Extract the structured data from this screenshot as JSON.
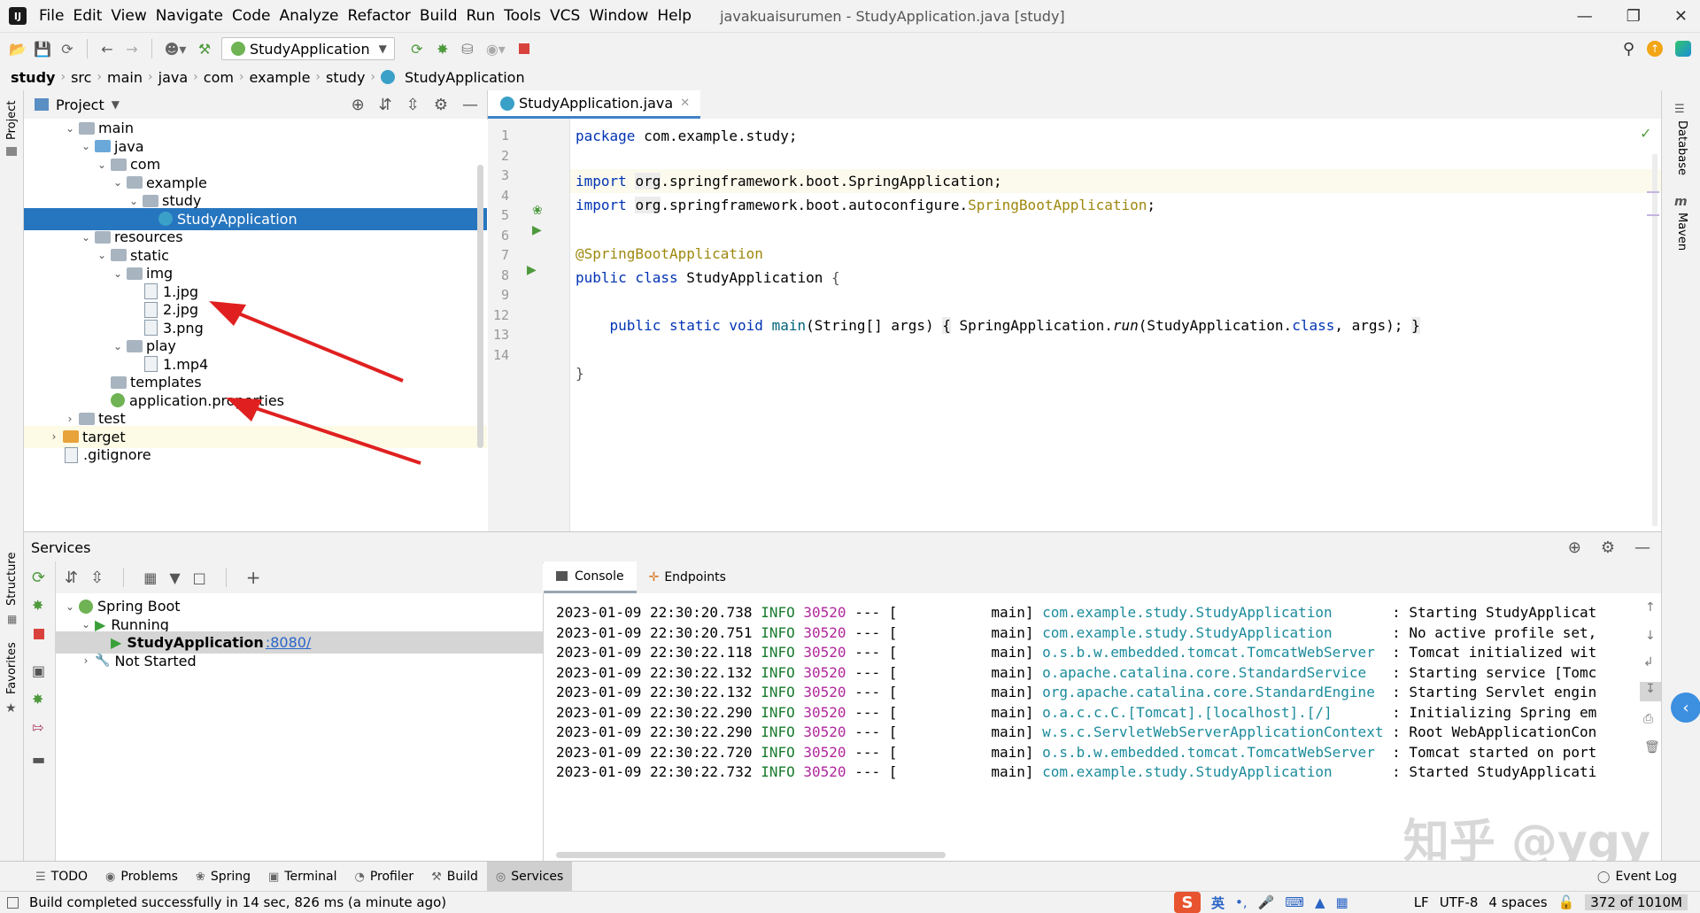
{
  "menu": [
    "File",
    "Edit",
    "View",
    "Navigate",
    "Code",
    "Analyze",
    "Refactor",
    "Build",
    "Run",
    "Tools",
    "VCS",
    "Window",
    "Help"
  ],
  "window_title": "javakuaisurumen - StudyApplication.java [study]",
  "toolbar": {
    "run_config": "StudyApplication"
  },
  "breadcrumbs": [
    "study",
    "src",
    "main",
    "java",
    "com",
    "example",
    "study",
    "StudyApplication"
  ],
  "left_strip": [
    "Project",
    "Structure",
    "Favorites"
  ],
  "right_strip": [
    "Database",
    "Maven"
  ],
  "project": {
    "header": "Project",
    "tree": [
      {
        "label": "main",
        "depth": 2,
        "chev": "v",
        "icon": "folder"
      },
      {
        "label": "java",
        "depth": 3,
        "chev": "v",
        "icon": "folder-blue"
      },
      {
        "label": "com",
        "depth": 4,
        "chev": "v",
        "icon": "folder"
      },
      {
        "label": "example",
        "depth": 5,
        "chev": "v",
        "icon": "folder"
      },
      {
        "label": "study",
        "depth": 6,
        "chev": "v",
        "icon": "folder"
      },
      {
        "label": "StudyApplication",
        "depth": 7,
        "chev": "",
        "icon": "class",
        "selected": true
      },
      {
        "label": "resources",
        "depth": 3,
        "chev": "v",
        "icon": "folder"
      },
      {
        "label": "static",
        "depth": 4,
        "chev": "v",
        "icon": "folder"
      },
      {
        "label": "img",
        "depth": 5,
        "chev": "v",
        "icon": "folder"
      },
      {
        "label": "1.jpg",
        "depth": 6,
        "chev": "",
        "icon": "file"
      },
      {
        "label": "2.jpg",
        "depth": 6,
        "chev": "",
        "icon": "file"
      },
      {
        "label": "3.png",
        "depth": 6,
        "chev": "",
        "icon": "file"
      },
      {
        "label": "play",
        "depth": 5,
        "chev": "v",
        "icon": "folder"
      },
      {
        "label": "1.mp4",
        "depth": 6,
        "chev": "",
        "icon": "file"
      },
      {
        "label": "templates",
        "depth": 4,
        "chev": "",
        "icon": "folder"
      },
      {
        "label": "application.properties",
        "depth": 4,
        "chev": "",
        "icon": "leaf"
      },
      {
        "label": "test",
        "depth": 2,
        "chev": ">",
        "icon": "folder"
      },
      {
        "label": "target",
        "depth": 1,
        "chev": ">",
        "icon": "folder-orange",
        "highlight": true
      },
      {
        "label": ".gitignore",
        "depth": 1,
        "chev": "",
        "icon": "file"
      }
    ]
  },
  "editor": {
    "tab": "StudyApplication.java",
    "line_numbers": [
      "1",
      "2",
      "3",
      "4",
      "5",
      "6",
      "7",
      "8",
      "9",
      "12",
      "13",
      "14"
    ]
  },
  "services": {
    "header": "Services",
    "tree": [
      {
        "label": "Spring Boot",
        "depth": 0
      },
      {
        "label": "Running",
        "depth": 1
      },
      {
        "label": "StudyApplication",
        "port": ":8080/",
        "depth": 2,
        "selected": true
      },
      {
        "label": "Not Started",
        "depth": 1
      }
    ],
    "console_tabs": [
      "Console",
      "Endpoints"
    ],
    "logs": [
      {
        "ts": "2023-01-09 22:30:20.738",
        "lvl": "INFO",
        "pid": "30520",
        "thread": "---",
        "bracket": "[           main]",
        "logger": "com.example.study.StudyApplication      ",
        "msg": ": Starting StudyApplicat"
      },
      {
        "ts": "2023-01-09 22:30:20.751",
        "lvl": "INFO",
        "pid": "30520",
        "thread": "---",
        "bracket": "[           main]",
        "logger": "com.example.study.StudyApplication      ",
        "msg": ": No active profile set,"
      },
      {
        "ts": "2023-01-09 22:30:22.118",
        "lvl": "INFO",
        "pid": "30520",
        "thread": "---",
        "bracket": "[           main]",
        "logger": "o.s.b.w.embedded.tomcat.TomcatWebServer ",
        "msg": ": Tomcat initialized wit"
      },
      {
        "ts": "2023-01-09 22:30:22.132",
        "lvl": "INFO",
        "pid": "30520",
        "thread": "---",
        "bracket": "[           main]",
        "logger": "o.apache.catalina.core.StandardService  ",
        "msg": ": Starting service [Tomc"
      },
      {
        "ts": "2023-01-09 22:30:22.132",
        "lvl": "INFO",
        "pid": "30520",
        "thread": "---",
        "bracket": "[           main]",
        "logger": "org.apache.catalina.core.StandardEngine ",
        "msg": ": Starting Servlet engin"
      },
      {
        "ts": "2023-01-09 22:30:22.290",
        "lvl": "INFO",
        "pid": "30520",
        "thread": "---",
        "bracket": "[           main]",
        "logger": "o.a.c.c.C.[Tomcat].[localhost].[/]      ",
        "msg": ": Initializing Spring em"
      },
      {
        "ts": "2023-01-09 22:30:22.290",
        "lvl": "INFO",
        "pid": "30520",
        "thread": "---",
        "bracket": "[           main]",
        "logger": "w.s.c.ServletWebServerApplicationContext",
        "msg": ": Root WebApplicationCon"
      },
      {
        "ts": "2023-01-09 22:30:22.720",
        "lvl": "INFO",
        "pid": "30520",
        "thread": "---",
        "bracket": "[           main]",
        "logger": "o.s.b.w.embedded.tomcat.TomcatWebServer ",
        "msg": ": Tomcat started on port"
      },
      {
        "ts": "2023-01-09 22:30:22.732",
        "lvl": "INFO",
        "pid": "30520",
        "thread": "---",
        "bracket": "[           main]",
        "logger": "com.example.study.StudyApplication      ",
        "msg": ": Started StudyApplicati"
      }
    ]
  },
  "bottom_tabs": [
    "TODO",
    "Problems",
    "Spring",
    "Terminal",
    "Profiler",
    "Build",
    "Services"
  ],
  "bottom_active": "Services",
  "event_log": "Event Log",
  "status": {
    "message": "Build completed successfully in 14 sec, 826 ms (a minute ago)",
    "ime": [
      "英",
      "•,"
    ],
    "line_sep": "LF",
    "encoding": "UTF-8",
    "indent": "4 spaces",
    "memory": "372 of 1010M"
  },
  "watermark": "知乎 @ygy",
  "colors": {
    "accent": "#2675bf",
    "keyword": "#0033b3",
    "annotation": "#9e880d",
    "info": "#197b2e",
    "pid": "#b0279b",
    "logger": "#1b8b9c",
    "arrow": "#e02020"
  }
}
